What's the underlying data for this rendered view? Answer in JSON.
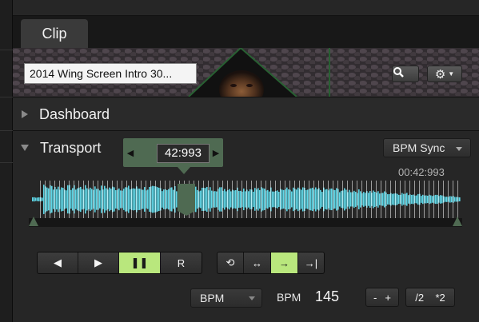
{
  "window": {
    "tab_label": "Clip"
  },
  "clip": {
    "name": "2014 Wing Screen Intro 30..."
  },
  "thumbnail_buttons": {
    "search_icon": "magnifier-icon",
    "settings_icon": "gear-icon"
  },
  "sections": {
    "dashboard": {
      "title": "Dashboard",
      "expanded": false
    },
    "transport": {
      "title": "Transport",
      "expanded": true
    }
  },
  "transport": {
    "position": "42:993",
    "elapsed": "00:42:993",
    "sync_mode": "BPM Sync",
    "playhead_fraction": 0.36,
    "playback_buttons": [
      {
        "name": "play-reverse-button",
        "label": "◀",
        "active": false
      },
      {
        "name": "play-forward-button",
        "label": "▶",
        "active": false
      },
      {
        "name": "pause-button",
        "label": "❚❚",
        "active": true
      },
      {
        "name": "restart-button",
        "label": "R",
        "active": false
      }
    ],
    "loop_buttons": [
      {
        "name": "loop-button",
        "label": "⟲",
        "active": false
      },
      {
        "name": "bounce-button",
        "label": "↔",
        "active": false
      },
      {
        "name": "play-once-button",
        "label": "→",
        "active": true
      },
      {
        "name": "play-once-hold-button",
        "label": "→|",
        "active": false
      }
    ],
    "bpm_mode": "BPM",
    "bpm_label": "BPM",
    "bpm_value": "145",
    "bpm_adjust": {
      "minus": "-",
      "plus": "+"
    },
    "bpm_scale": {
      "half": "/2",
      "double": "*2"
    }
  },
  "colors": {
    "accent_green": "#b9e77d",
    "handle_green": "#4f6a52",
    "waveform": "#5fd8e8"
  }
}
